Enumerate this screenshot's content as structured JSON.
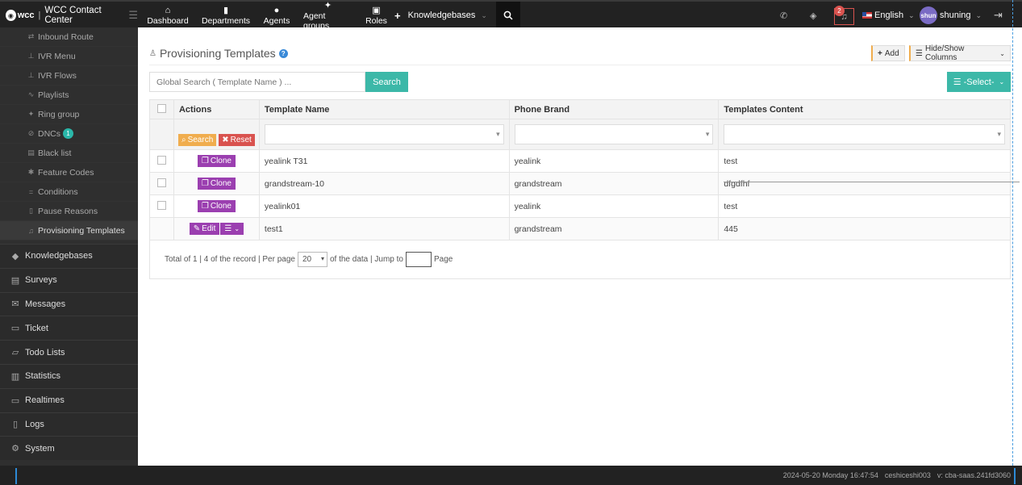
{
  "brand": {
    "logo": "wcc",
    "title": "WCC Contact Center"
  },
  "topnav": [
    {
      "label": "Dashboard",
      "icon": "home-icon"
    },
    {
      "label": "Departments",
      "icon": "document-icon"
    },
    {
      "label": "Agents",
      "icon": "person-icon"
    },
    {
      "label": "Agent groups",
      "icon": "group-icon"
    },
    {
      "label": "Roles",
      "icon": "roles-icon"
    }
  ],
  "kb_menu": {
    "label": "Knowledgebases"
  },
  "notifications": {
    "count": "2"
  },
  "language": {
    "label": "English"
  },
  "user": {
    "avatar": "shun",
    "name": "shuning"
  },
  "sidebar": {
    "sub_items": [
      {
        "label": "Inbound Route",
        "icon": "shuffle-icon"
      },
      {
        "label": "IVR Menu",
        "icon": "sitemap-icon"
      },
      {
        "label": "IVR Flows",
        "icon": "sitemap-icon"
      },
      {
        "label": "Playlists",
        "icon": "rss-icon"
      },
      {
        "label": "Ring group",
        "icon": "group-icon"
      },
      {
        "label": "DNCs",
        "icon": "ban-icon",
        "badge": "1"
      },
      {
        "label": "Black list",
        "icon": "doc-icon"
      },
      {
        "label": "Feature Codes",
        "icon": "asterisk-icon"
      },
      {
        "label": "Conditions",
        "icon": "equals-icon"
      },
      {
        "label": "Pause Reasons",
        "icon": "pause-icon"
      },
      {
        "label": "Provisioning Templates",
        "icon": "music-icon",
        "active": true
      }
    ],
    "main_items": [
      {
        "label": "Knowledgebases",
        "icon": "graduation-cap-icon"
      },
      {
        "label": "Surveys",
        "icon": "survey-icon"
      },
      {
        "label": "Messages",
        "icon": "envelope-icon"
      },
      {
        "label": "Ticket",
        "icon": "folder-icon"
      },
      {
        "label": "Todo Lists",
        "icon": "folder-open-icon"
      },
      {
        "label": "Statistics",
        "icon": "bar-chart-icon"
      },
      {
        "label": "Realtimes",
        "icon": "monitor-icon"
      },
      {
        "label": "Logs",
        "icon": "tablet-icon"
      },
      {
        "label": "System",
        "icon": "gear-icon"
      }
    ]
  },
  "page": {
    "title": "Provisioning Templates",
    "add_label": "Add",
    "hide_show_label": "Hide/Show Columns",
    "search_placeholder": "Global Search ( Template Name ) ...",
    "search_button": "Search",
    "select_button": "-Select-"
  },
  "table": {
    "columns": [
      "Actions",
      "Template Name",
      "Phone Brand",
      "Templates Content"
    ],
    "filter_search": "Search",
    "filter_reset": "Reset",
    "rows": [
      {
        "action": "Clone",
        "name": "yealink T31",
        "brand": "yealink",
        "content": "test"
      },
      {
        "action": "Clone",
        "name": "grandstream-10",
        "brand": "grandstream",
        "content": "dfgdfhf"
      },
      {
        "action": "Clone",
        "name": "yealink01",
        "brand": "yealink",
        "content": "test"
      },
      {
        "action": "Edit",
        "name": "test1",
        "brand": "grandstream",
        "content": "445"
      }
    ]
  },
  "pager": {
    "summary": "Total of 1 | 4 of the record | Per page",
    "per_page": "20",
    "after_per_page": "of the data | Jump to",
    "page_suffix": "Page"
  },
  "footer": {
    "datetime": "2024-05-20 Monday 16:47:54",
    "account": "ceshiceshi003",
    "version": "v: cba-saas.241fd3060"
  }
}
